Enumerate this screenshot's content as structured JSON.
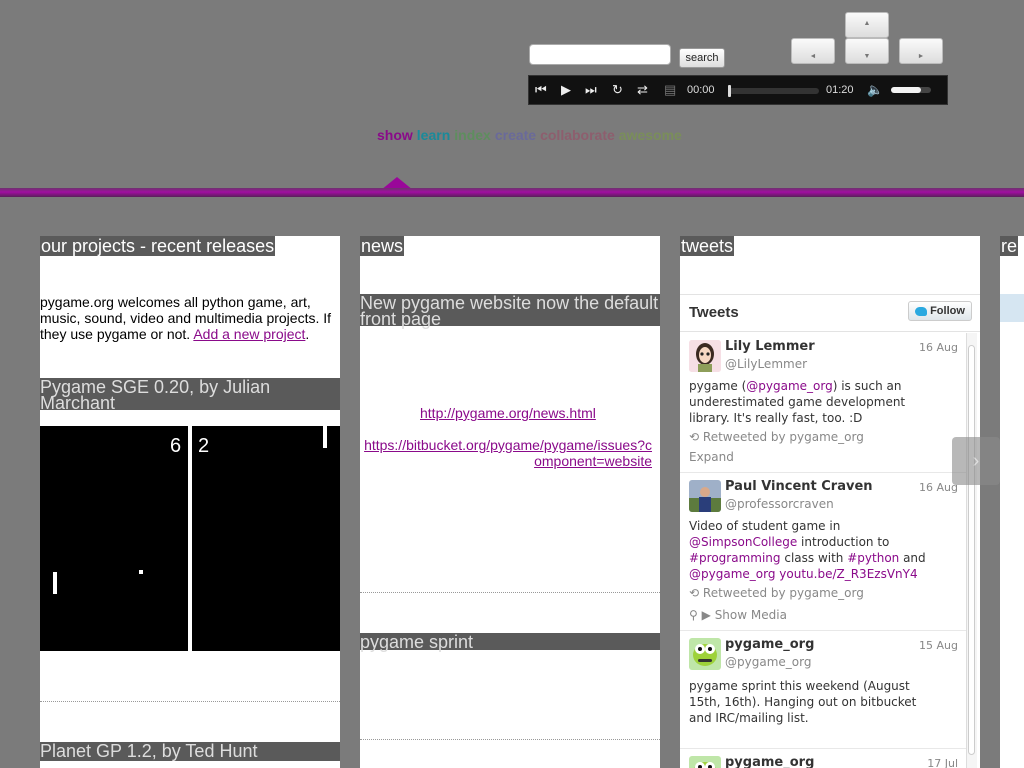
{
  "search": {
    "placeholder": "",
    "button_label": "search"
  },
  "nav_buttons": {
    "up": "▲",
    "down": "▼",
    "left": "◄",
    "right": "►"
  },
  "player": {
    "current_time": "00:00",
    "duration": "01:20",
    "progress": 0.0,
    "volume": 0.75
  },
  "section_nav": [
    {
      "label": "show",
      "color": "#8a0a8a"
    },
    {
      "label": "learn",
      "color": "#1a8a9a"
    },
    {
      "label": "index",
      "color": "#5e8e5e"
    },
    {
      "label": "create",
      "color": "#6a6a9a"
    },
    {
      "label": "collaborate",
      "color": "#8e5e6e"
    },
    {
      "label": "awesome",
      "color": "#7a8e5a"
    }
  ],
  "projects": {
    "heading": "our projects - recent releases",
    "intro": "pygame.org welcomes all python game, art, music, sound, video and multimedia projects. If they use pygame or not.",
    "intro_link": "Add a new project",
    "intro_end": ".",
    "item1_title": "Pygame SGE 0.20, by Julian Marchant",
    "score_left": "6",
    "score_right": "2",
    "item2_title": "Planet GP 1.2, by Ted Hunt"
  },
  "news": {
    "heading": "news",
    "item1_title": "New pygame website now the default front page",
    "link1": "http://pygame.org/news.html",
    "link2": "https://bitbucket.org/pygame/pygame/issues?component=website",
    "item2_title": "pygame sprint"
  },
  "tweets": {
    "heading": "tweets",
    "widget_title": "Tweets",
    "follow_label": "Follow",
    "items": [
      {
        "name": "Lily Lemmer",
        "handle": "@LilyLemmer",
        "date": "16 Aug",
        "text_before": "pygame (",
        "mention": "@pygame_org",
        "text_after": ") is such an underestimated game development library. It's really fast, too. :D",
        "retweet": "Retweeted by pygame_org",
        "action": "Expand"
      },
      {
        "name": "Paul Vincent Craven",
        "handle": "@professorcraven",
        "date": "16 Aug",
        "t1": "Video of student game in ",
        "m1": "@SimpsonCollege",
        "t2": " introduction to ",
        "m2": "#programming",
        "t3": " class with ",
        "m3": "#python",
        "t4": " and ",
        "m4": "@pygame_org",
        "t5": " ",
        "m5": "youtu.be/Z_R3EzsVnY4",
        "retweet": "Retweeted by pygame_org",
        "action": "Show Media"
      },
      {
        "name": "pygame_org",
        "handle": "@pygame_org",
        "date": "15 Aug",
        "text": "pygame sprint this weekend (August 15th, 16th). Hanging out on bitbucket and IRC/mailing list."
      },
      {
        "name": "pygame_org",
        "date": "17 Jul"
      }
    ]
  },
  "fourth_column_heading_fragment": "re",
  "icons": {
    "retweet": "⟲",
    "location": "⚲",
    "media": "▶",
    "side_arrow": "›"
  }
}
